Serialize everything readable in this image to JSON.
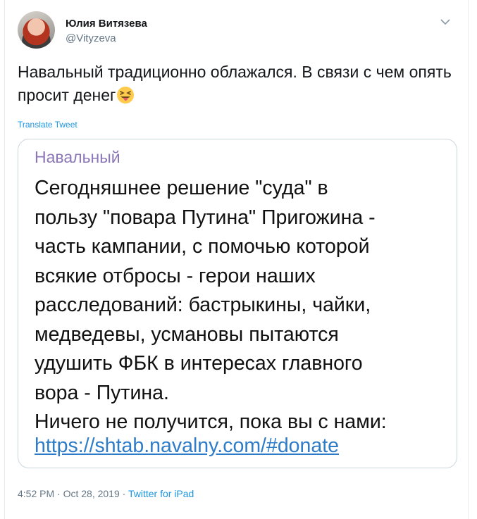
{
  "author": {
    "name": "Юлия Витязева",
    "handle": "@Vityzeva"
  },
  "tweet": {
    "text": "Навальный традиционно облажался. В связи с чем опять просит денег",
    "emoji": "squinting-tongue-emoji",
    "translate_label": "Translate Tweet"
  },
  "quote_card": {
    "author": "Навальный",
    "lines": [
      "Сегодняшнее решение \"суда\" в",
      "пользу \"повара Путина\" Пригожина -",
      "часть кампании, с помочью которой",
      "всякие отбросы - герои наших",
      "расследований: бастрыкины, чайки,",
      "медведевы, усмановы пытаются",
      "удушить ФБК в интересах главного",
      "вора - Путина.",
      "Ничего не получится, пока вы с нами:"
    ],
    "link": "https://shtab.navalny.com/#donate"
  },
  "meta": {
    "time": "4:52 PM",
    "date": "Oct 28, 2019",
    "separator": "·",
    "source": "Twitter for iPad"
  },
  "colors": {
    "link_blue": "#1b95e0",
    "card_author": "#8b76b7",
    "card_link": "#2e7cc7",
    "muted": "#657786"
  }
}
